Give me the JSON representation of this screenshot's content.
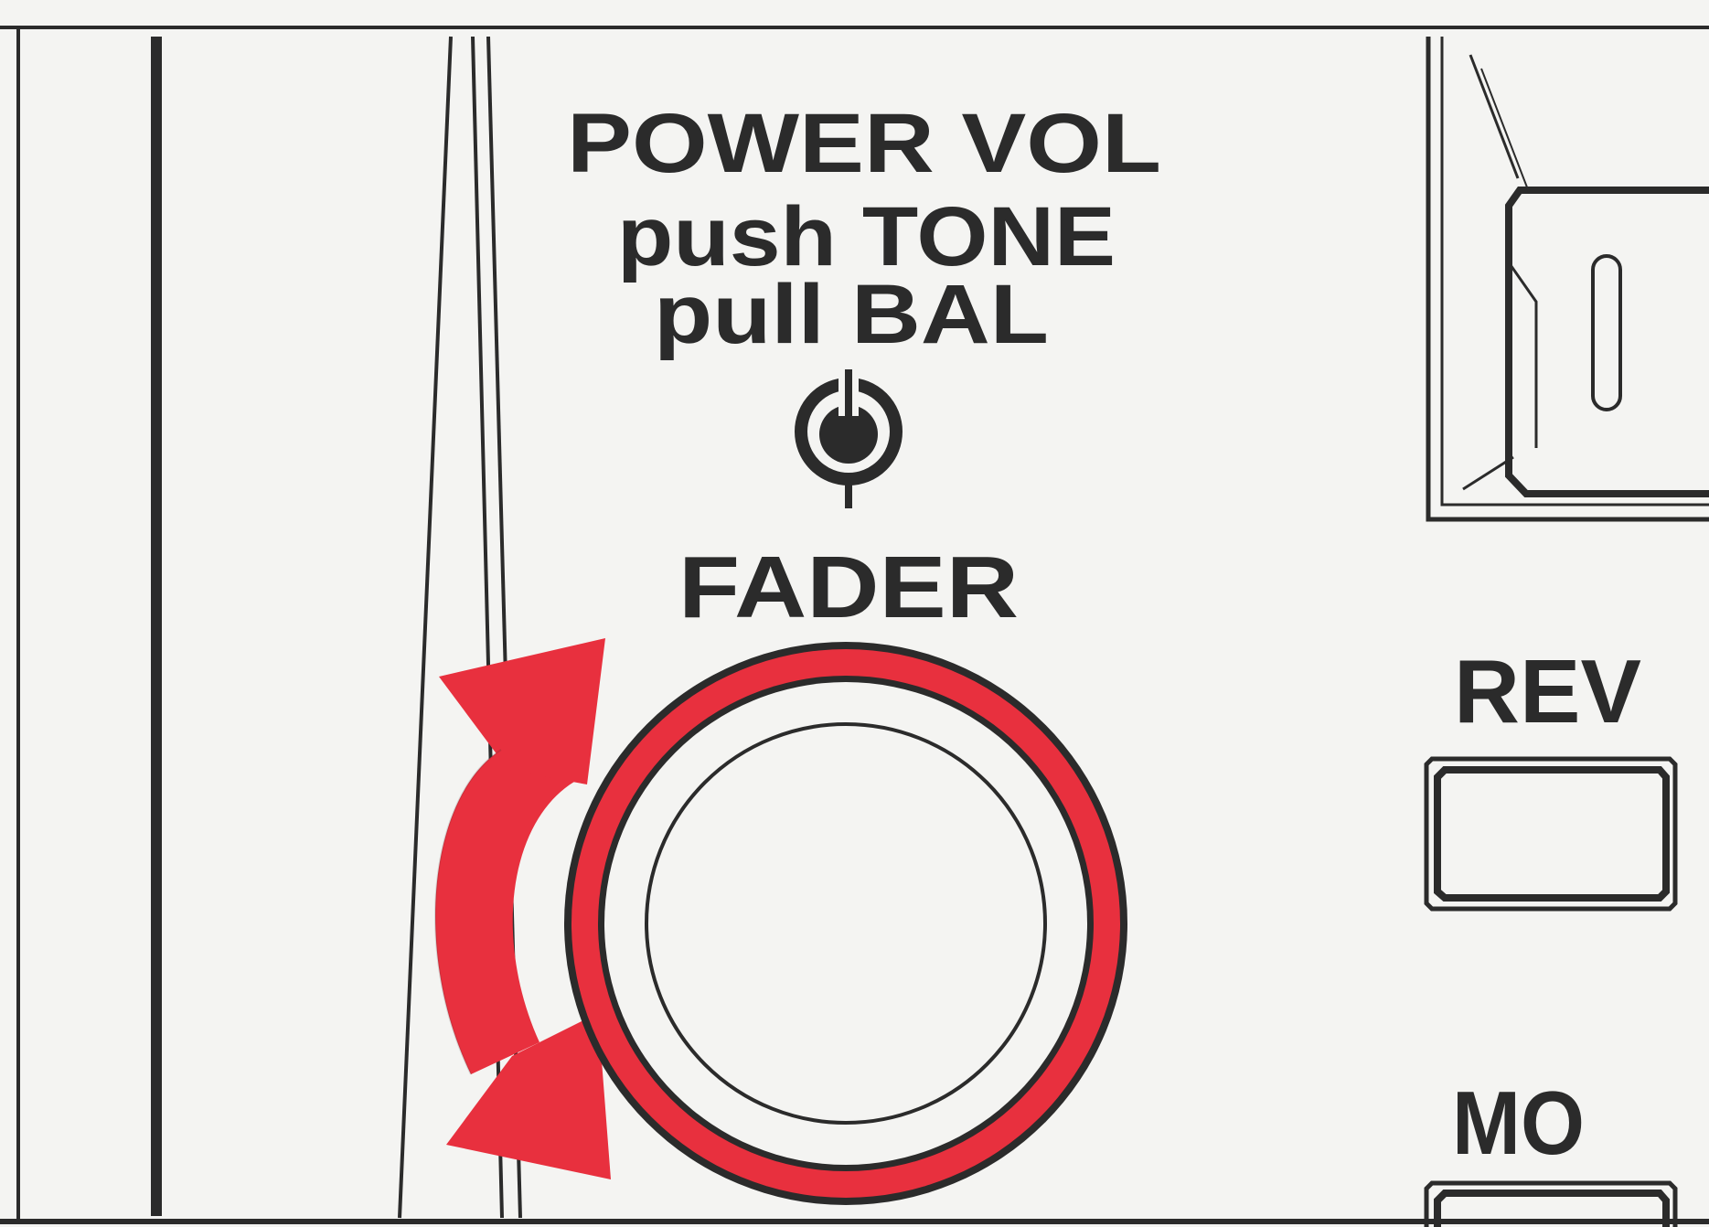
{
  "panel": {
    "knob_label": {
      "line1": "POWER VOL",
      "line2": "push TONE",
      "line3": "pull BAL"
    },
    "fader_label": "FADER",
    "buttons": [
      {
        "label": "REV"
      },
      {
        "label": "MO"
      }
    ],
    "knob_indicator_icon": "power-symbol-icon",
    "rotation_arrow_icon": "double-curved-arrow-icon"
  },
  "colors": {
    "background": "#f4f4f2",
    "ink": "#2b2b2b",
    "highlight_red": "#e8303e"
  }
}
